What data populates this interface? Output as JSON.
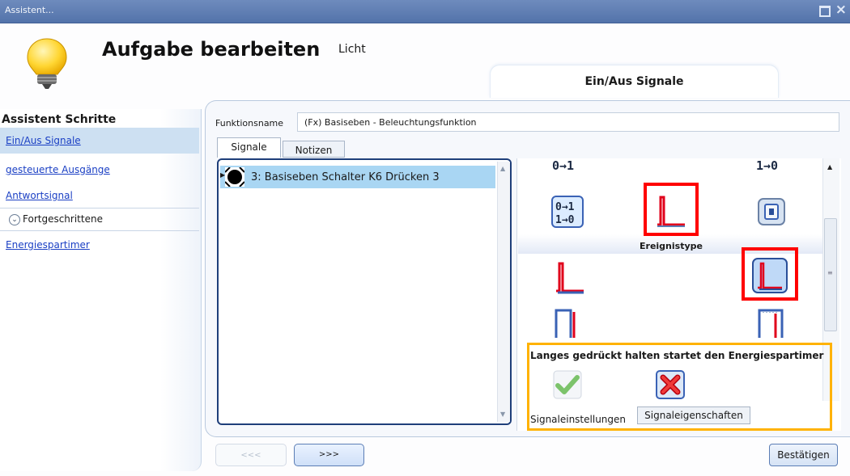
{
  "window": {
    "title": "Assistent..."
  },
  "header": {
    "title": "Aufgabe bearbeiten",
    "subtitle": "Licht",
    "step_tab": "Ein/Aus Signale"
  },
  "wizard": {
    "heading": "Assistent Schritte",
    "items": [
      {
        "label": "Ein/Aus Signale",
        "selected": true
      },
      {
        "label": "gesteuerte Ausgänge"
      },
      {
        "label": "Antwortsignal"
      }
    ],
    "advanced_label": "Fortgeschrittene",
    "advanced_items": [
      {
        "label": "Energiespartimer"
      }
    ]
  },
  "function": {
    "label": "Funktionsname",
    "value": "(Fx) Basiseben - Beleuchtungsfunktion"
  },
  "tabs": [
    {
      "label": "Signale",
      "active": true
    },
    {
      "label": "Notizen"
    }
  ],
  "signals": [
    {
      "label": "3: Basiseben Schalter K6 Drücken 3",
      "selected": true
    }
  ],
  "config": {
    "top_icons": [
      {
        "label": "0→1",
        "icon": "rising-edge-icon"
      },
      {
        "label": "1→0",
        "icon": "falling-edge-icon"
      }
    ],
    "event_type_label": "Ereignistype",
    "long_press_label": "Langes gedrückt halten startet den Energiespartimer",
    "signal_settings_label": "Signaleinstellungen",
    "signal_properties_button": "Signaleigenschaften"
  },
  "footer": {
    "back_label": "<<<",
    "next_label": ">>>",
    "confirm_label": "Bestätigen"
  },
  "colors": {
    "highlight_red": "#ff0000",
    "highlight_yellow": "#ffb200",
    "selection_blue": "#a9d6f3",
    "title_bar": "#5f7fb3"
  }
}
